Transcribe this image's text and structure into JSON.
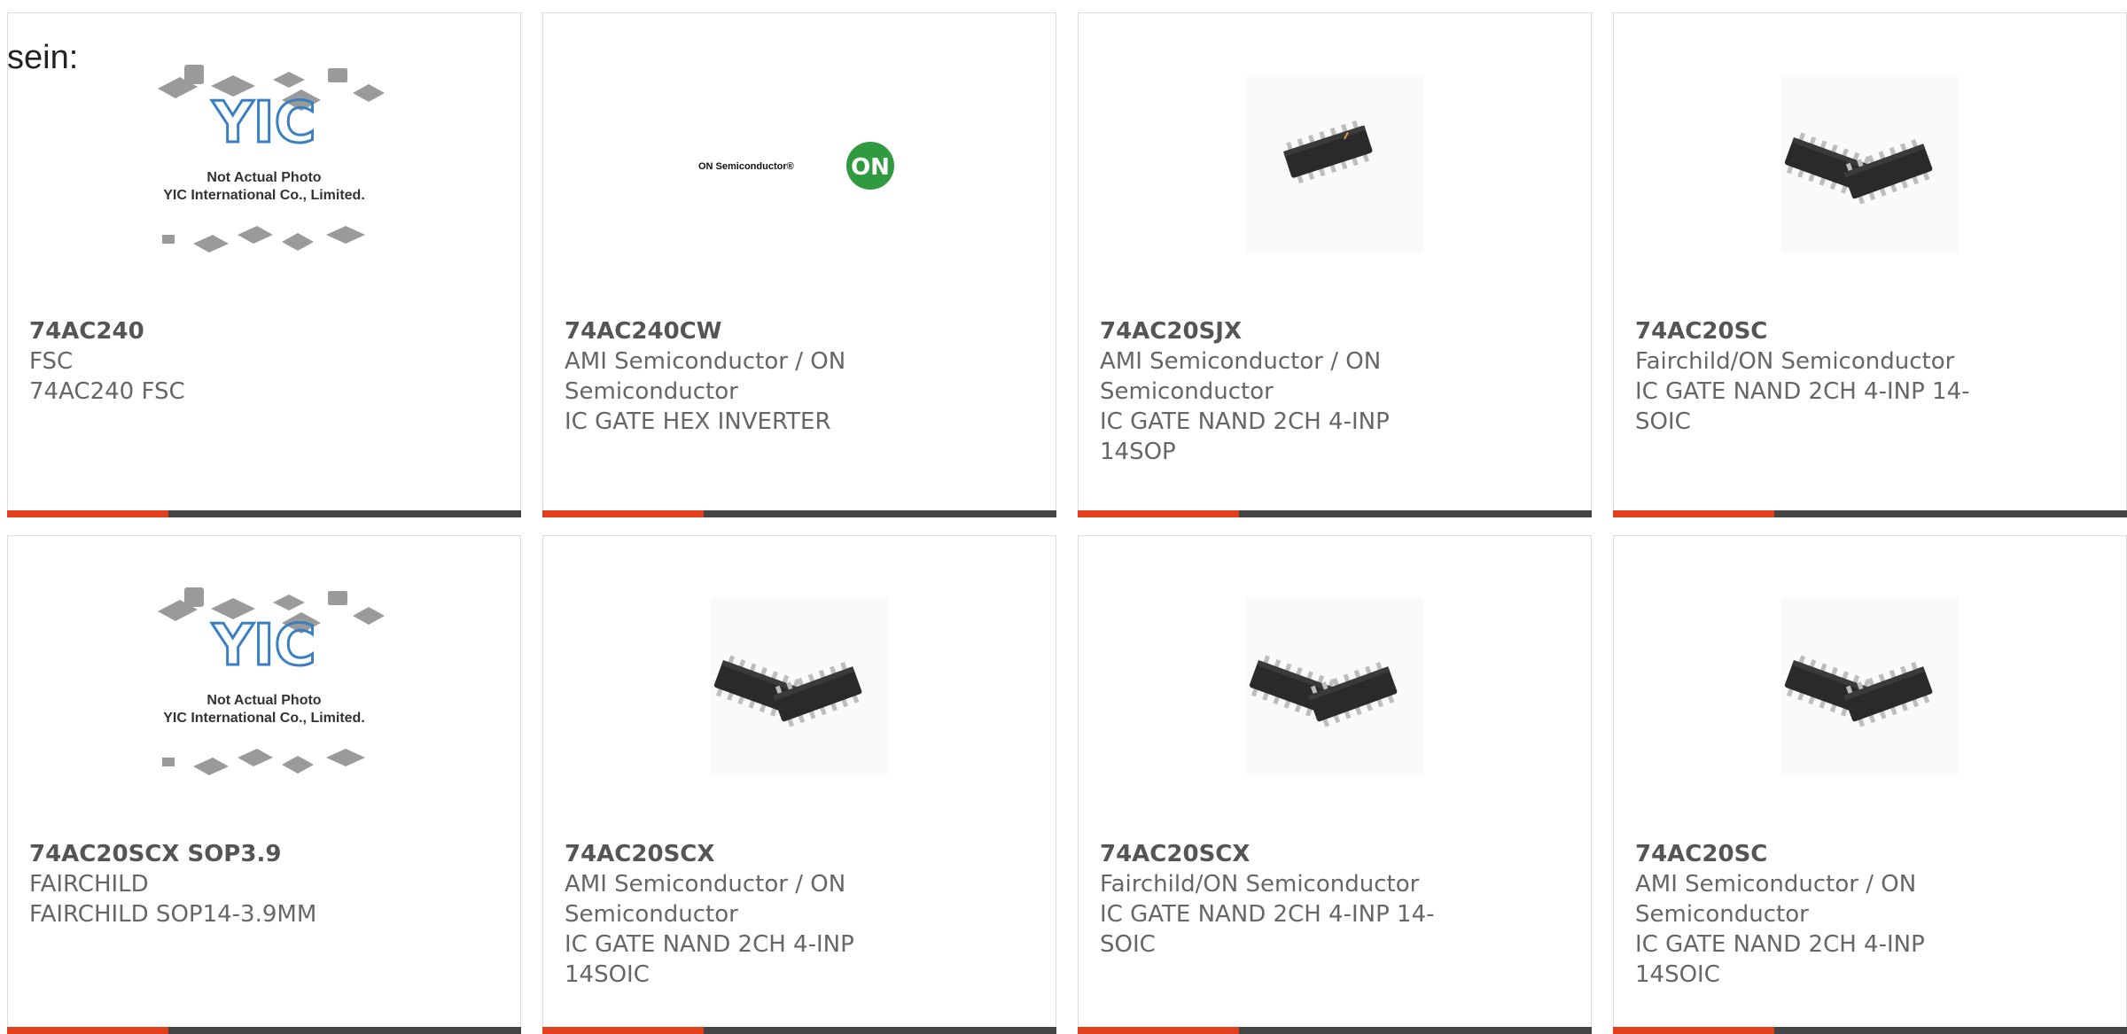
{
  "page_fragment": "sein:",
  "colors": {
    "accent": "#e2401c",
    "bar": "#444444",
    "border": "#dcdcdc",
    "text": "#666666"
  },
  "products": [
    {
      "part": "74AC240",
      "manufacturer": "FSC",
      "description": "74AC240 FSC",
      "image": "yic-placeholder",
      "placeholder_line1": "Not Actual Photo",
      "placeholder_line2": "YIC International Co., Limited."
    },
    {
      "part": "74AC240CW",
      "manufacturer": "AMI Semiconductor / ON Semiconductor",
      "description": "IC GATE HEX INVERTER",
      "image": "on-semiconductor-logo",
      "logo_text": "ON Semiconductor®",
      "logo_mark": "ON"
    },
    {
      "part": "74AC20SJX",
      "manufacturer": "AMI Semiconductor / ON Semiconductor",
      "description": "IC GATE NAND 2CH 4-INP 14SOP",
      "image": "single-soic-chip"
    },
    {
      "part": "74AC20SC",
      "manufacturer": "Fairchild/ON Semiconductor",
      "description": "IC GATE NAND 2CH 4-INP 14-SOIC",
      "image": "dual-soic-chips"
    },
    {
      "part": "74AC20SCX SOP3.9",
      "manufacturer": "FAIRCHILD",
      "description": "FAIRCHILD SOP14-3.9MM",
      "image": "yic-placeholder",
      "placeholder_line1": "Not Actual Photo",
      "placeholder_line2": "YIC International Co., Limited."
    },
    {
      "part": "74AC20SCX",
      "manufacturer": "AMI Semiconductor / ON Semiconductor",
      "description": "IC GATE NAND 2CH 4-INP 14SOIC",
      "image": "dual-soic-chips"
    },
    {
      "part": "74AC20SCX",
      "manufacturer": "Fairchild/ON Semiconductor",
      "description": "IC GATE NAND 2CH 4-INP 14-SOIC",
      "image": "dual-soic-chips"
    },
    {
      "part": "74AC20SC",
      "manufacturer": "AMI Semiconductor / ON Semiconductor",
      "description": "IC GATE NAND 2CH 4-INP 14SOIC",
      "image": "dual-soic-chips"
    }
  ]
}
